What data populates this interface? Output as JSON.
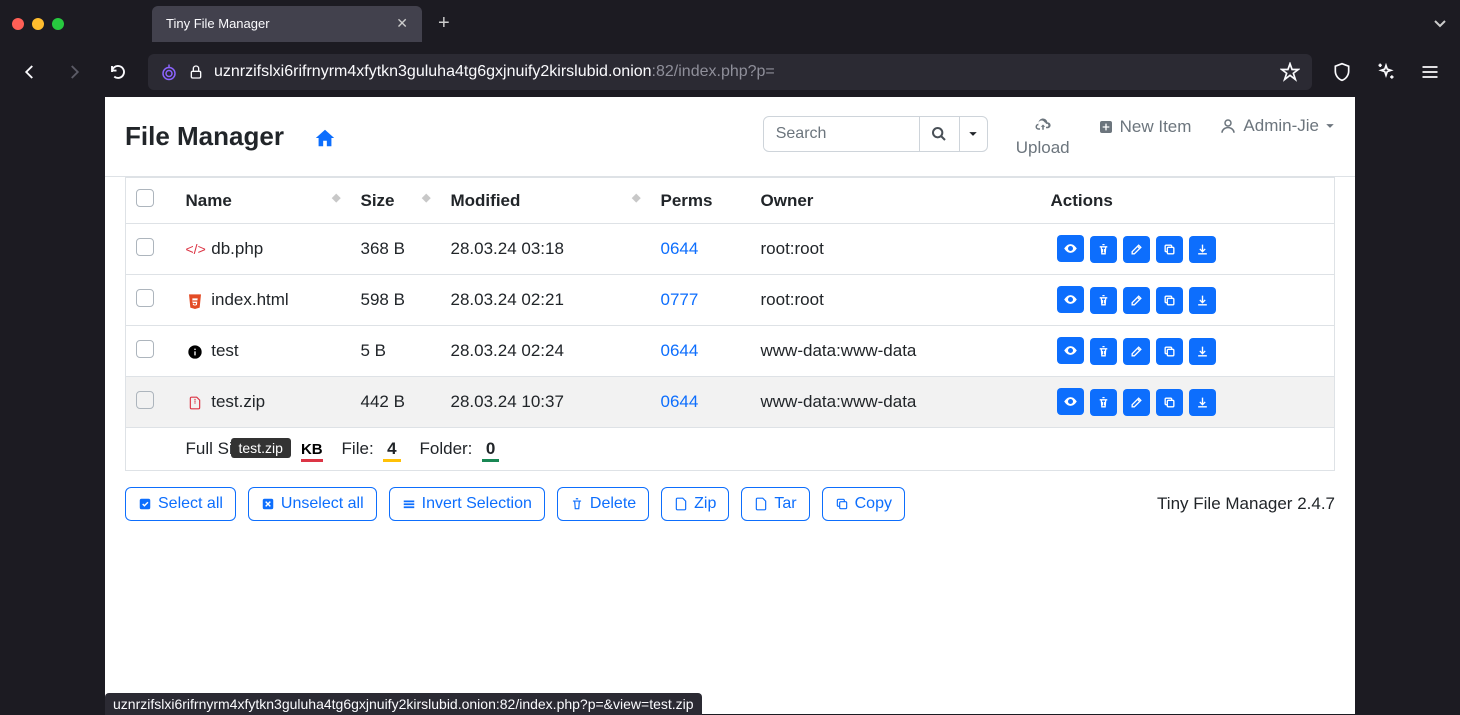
{
  "browser": {
    "tab_title": "Tiny File Manager",
    "url_host": "uznrzifslxi6rifrnyrm4xfytkn3guluha4tg6gxjnuify2kirslubid.onion",
    "url_port": ":82",
    "url_path": "/index.php?p=",
    "status_bar": "uznrzifslxi6rifrnyrm4xfytkn3guluha4tg6gxjnuify2kirslubid.onion:82/index.php?p=&view=test.zip"
  },
  "nav": {
    "brand": "File Manager",
    "search_placeholder": "Search",
    "upload": "Upload",
    "new_item": "New Item",
    "user": "Admin-Jie"
  },
  "table": {
    "headers": {
      "name": "Name",
      "size": "Size",
      "modified": "Modified",
      "perms": "Perms",
      "owner": "Owner",
      "actions": "Actions"
    },
    "rows": [
      {
        "icon": "code",
        "name": "db.php",
        "size": "368 B",
        "modified": "28.03.24 03:18",
        "perms": "0644",
        "owner": "root:root"
      },
      {
        "icon": "html",
        "name": "index.html",
        "size": "598 B",
        "modified": "28.03.24 02:21",
        "perms": "0777",
        "owner": "root:root"
      },
      {
        "icon": "info",
        "name": "test",
        "size": "5 B",
        "modified": "28.03.24 02:24",
        "perms": "0644",
        "owner": "www-data:www-data"
      },
      {
        "icon": "zip",
        "name": "test.zip",
        "size": "442 B",
        "modified": "28.03.24 10:37",
        "perms": "0644",
        "owner": "www-data:www-data"
      }
    ]
  },
  "summary": {
    "full_size_label": "Full Siz",
    "tooltip": "test.zip",
    "size_unit": "KB",
    "file_label": "File:",
    "file_count": "4",
    "folder_label": "Folder:",
    "folder_count": "0"
  },
  "buttons": {
    "select_all": "Select all",
    "unselect_all": "Unselect all",
    "invert": "Invert Selection",
    "delete": "Delete",
    "zip": "Zip",
    "tar": "Tar",
    "copy": "Copy"
  },
  "footer": "Tiny File Manager 2.4.7"
}
